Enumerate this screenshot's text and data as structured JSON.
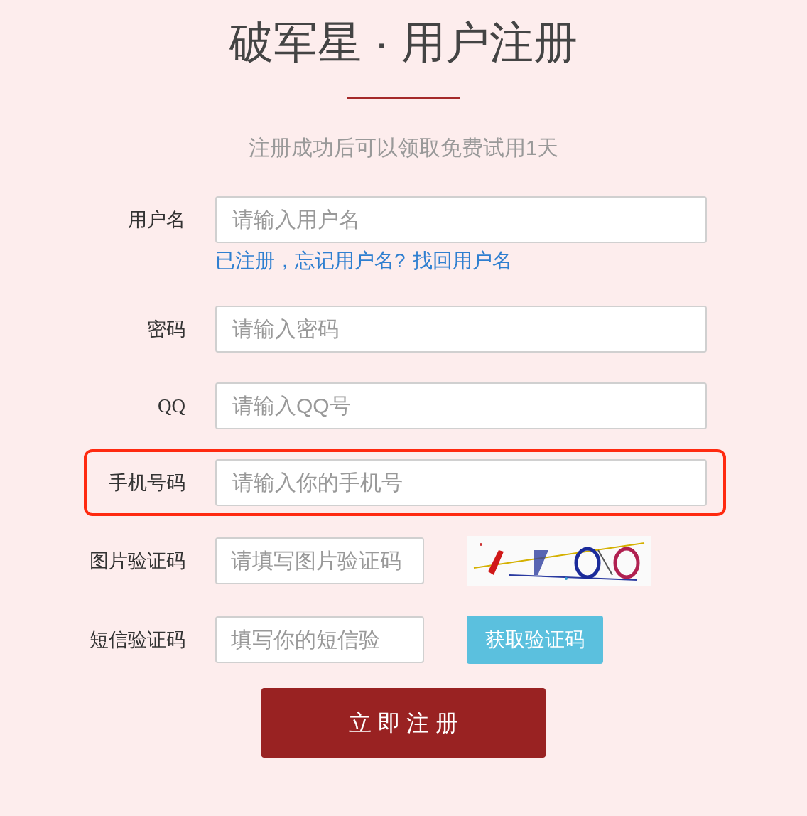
{
  "title": "破军星 · 用户注册",
  "subtitle": "注册成功后可以领取免费试用1天",
  "fields": [
    {
      "kind": "wide",
      "label": "用户名",
      "placeholder": "请输入用户名",
      "highlighted": false,
      "hint": "已注册，忘记用户名?",
      "hint_link": "找回用户名"
    },
    {
      "kind": "wide",
      "label": "密码",
      "placeholder": "请输入密码",
      "highlighted": false
    },
    {
      "kind": "wide",
      "label": "QQ",
      "placeholder": "请输入QQ号",
      "highlighted": false
    },
    {
      "kind": "wide",
      "label": "手机号码",
      "placeholder": "请输入你的手机号",
      "highlighted": true
    },
    {
      "kind": "captcha",
      "label": "图片验证码",
      "placeholder": "请填写图片验证码",
      "highlighted": false
    },
    {
      "kind": "sms",
      "label": "短信验证码",
      "placeholder": "填写你的短信验",
      "highlighted": false,
      "button": "获取验证码"
    }
  ],
  "submit": "立 即 注 册"
}
